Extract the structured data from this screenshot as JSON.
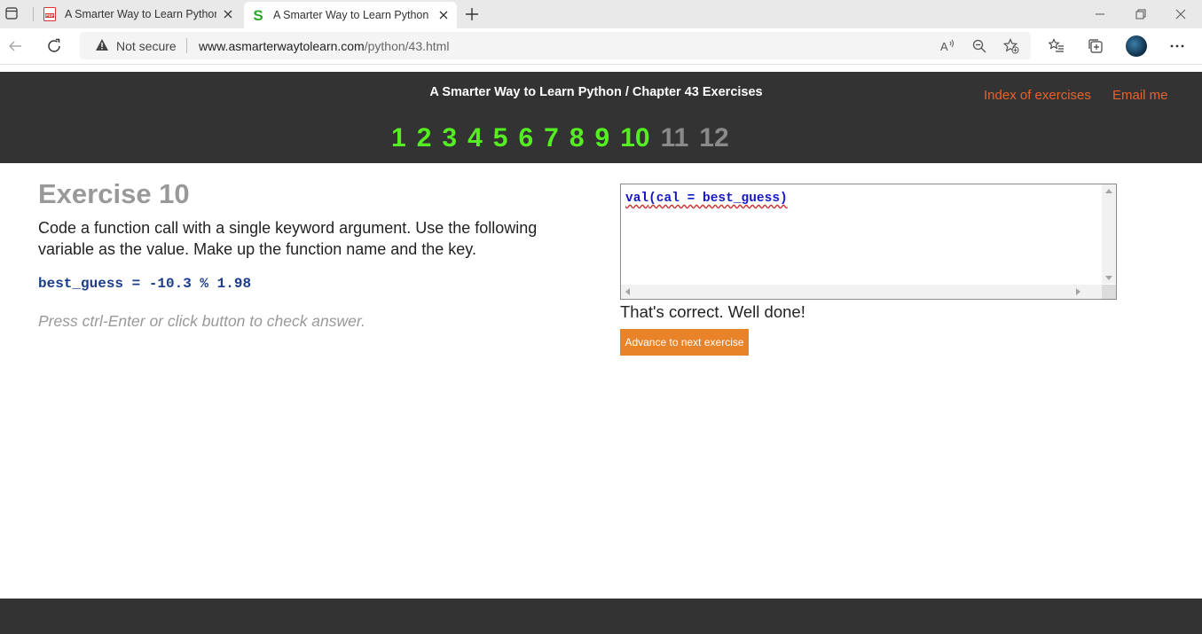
{
  "browser": {
    "tabs": [
      {
        "title": "A Smarter Way to Learn Python -",
        "favicon": "pdf-icon",
        "active": false
      },
      {
        "title": "A Smarter Way to Learn Python -",
        "favicon": "s-logo-icon",
        "active": true
      }
    ],
    "security_label": "Not secure",
    "url_host": "www.asmarterwaytolearn.com",
    "url_path": "/python/43.html"
  },
  "header": {
    "title": "A Smarter Way to Learn Python / Chapter 43 Exercises",
    "index_link": "Index of exercises",
    "email_link": "Email me",
    "chapters": [
      "1",
      "2",
      "3",
      "4",
      "5",
      "6",
      "7",
      "8",
      "9",
      "10",
      "11",
      "12"
    ],
    "completed_through": 10
  },
  "exercise": {
    "title": "Exercise 10",
    "description": "Code a function call with a single keyword argument. Use the following variable as the value. Make up the function name and the key.",
    "code": "best_guess = -10.3 % 1.98",
    "hint": "Press ctrl-Enter or click button to check answer."
  },
  "editor": {
    "code_func": "val",
    "code_rest": "(cal = best_guess)"
  },
  "result": {
    "message": "That's correct. Well done!",
    "advance_label": "Advance to next exercise"
  },
  "colors": {
    "header_bg": "#333333",
    "link_orange": "#e8622a",
    "done_green": "#55ee22",
    "button_orange": "#e8832a"
  }
}
